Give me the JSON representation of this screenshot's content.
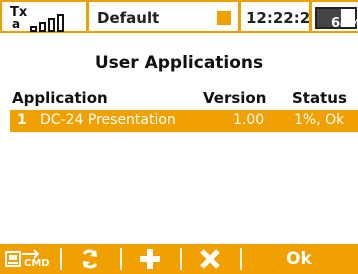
{
  "status_bar": {
    "tx_label": "Tx",
    "tx_sub": "a",
    "model_name": "Default",
    "time": "12:22:22",
    "battery": "64%",
    "battery_level": 0.64,
    "accent": "#f0a000"
  },
  "screen": {
    "title": "User Applications"
  },
  "table": {
    "columns": [
      "Application",
      "Version",
      "Status"
    ],
    "rows": [
      {
        "index": "1",
        "name": "DC-24 Presentation",
        "version": "1.00",
        "status": "1%, Ok"
      }
    ]
  },
  "toolbar": {
    "icons": [
      "transmitter-cmd-icon",
      "refresh-icon",
      "add-icon",
      "delete-icon"
    ],
    "cmd_label": "CMD",
    "ok_label": "Ok"
  }
}
